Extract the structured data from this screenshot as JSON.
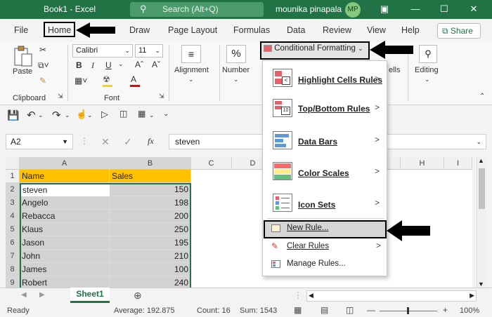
{
  "titlebar": {
    "doc_title": "Book1  -  Excel",
    "search_placeholder": "Search (Alt+Q)",
    "user_name": "mounika pinapala",
    "avatar_initials": "MP",
    "accent": "#217346"
  },
  "menu": {
    "items": [
      "File",
      "Home",
      "Draw",
      "Page Layout",
      "Formulas",
      "Data",
      "Review",
      "View",
      "Help"
    ],
    "share_label": "Share"
  },
  "ribbon": {
    "paste_label": "Paste",
    "clipboard_label": "Clipboard",
    "font_name": "Calibri",
    "font_size": "11",
    "font_label": "Font",
    "alignment_label": "Alignment",
    "number_label": "Number",
    "percent_symbol": "%",
    "cells_label": "ells",
    "editing_label": "Editing",
    "cond_format_label": "Conditional Formatting"
  },
  "formula_bar": {
    "cell_ref": "A2",
    "fx_symbol": "fx",
    "content": "steven"
  },
  "grid": {
    "columns": [
      "A",
      "B",
      "C",
      "D",
      "H",
      "I"
    ],
    "rows": [
      "1",
      "2",
      "3",
      "4",
      "5",
      "6",
      "7",
      "8",
      "9"
    ],
    "header": {
      "name": "Name",
      "sales": "Sales"
    },
    "data": [
      {
        "name": "steven",
        "sales": "150"
      },
      {
        "name": "Angelo",
        "sales": "198"
      },
      {
        "name": "Rebacca",
        "sales": "200"
      },
      {
        "name": "Klaus",
        "sales": "250"
      },
      {
        "name": "Jason",
        "sales": "195"
      },
      {
        "name": "John",
        "sales": "210"
      },
      {
        "name": "James",
        "sales": "100"
      },
      {
        "name": "Robert",
        "sales": "240"
      }
    ]
  },
  "cf_menu": {
    "items": [
      {
        "label": "Highlight Cells Rules",
        "chevron": ">"
      },
      {
        "label": "Top/Bottom Rules",
        "chevron": ">"
      },
      {
        "label": "Data Bars",
        "chevron": ">"
      },
      {
        "label": "Color Scales",
        "chevron": ">"
      },
      {
        "label": "Icon Sets",
        "chevron": ">"
      },
      {
        "label": "New Rule..."
      },
      {
        "label": "Clear Rules",
        "chevron": ">"
      },
      {
        "label": "Manage Rules..."
      }
    ]
  },
  "sheets": {
    "active": "Sheet1"
  },
  "status": {
    "ready": "Ready",
    "average": "Average: 192.875",
    "count": "Count: 16",
    "sum": "Sum: 1543",
    "zoom": "100%"
  }
}
